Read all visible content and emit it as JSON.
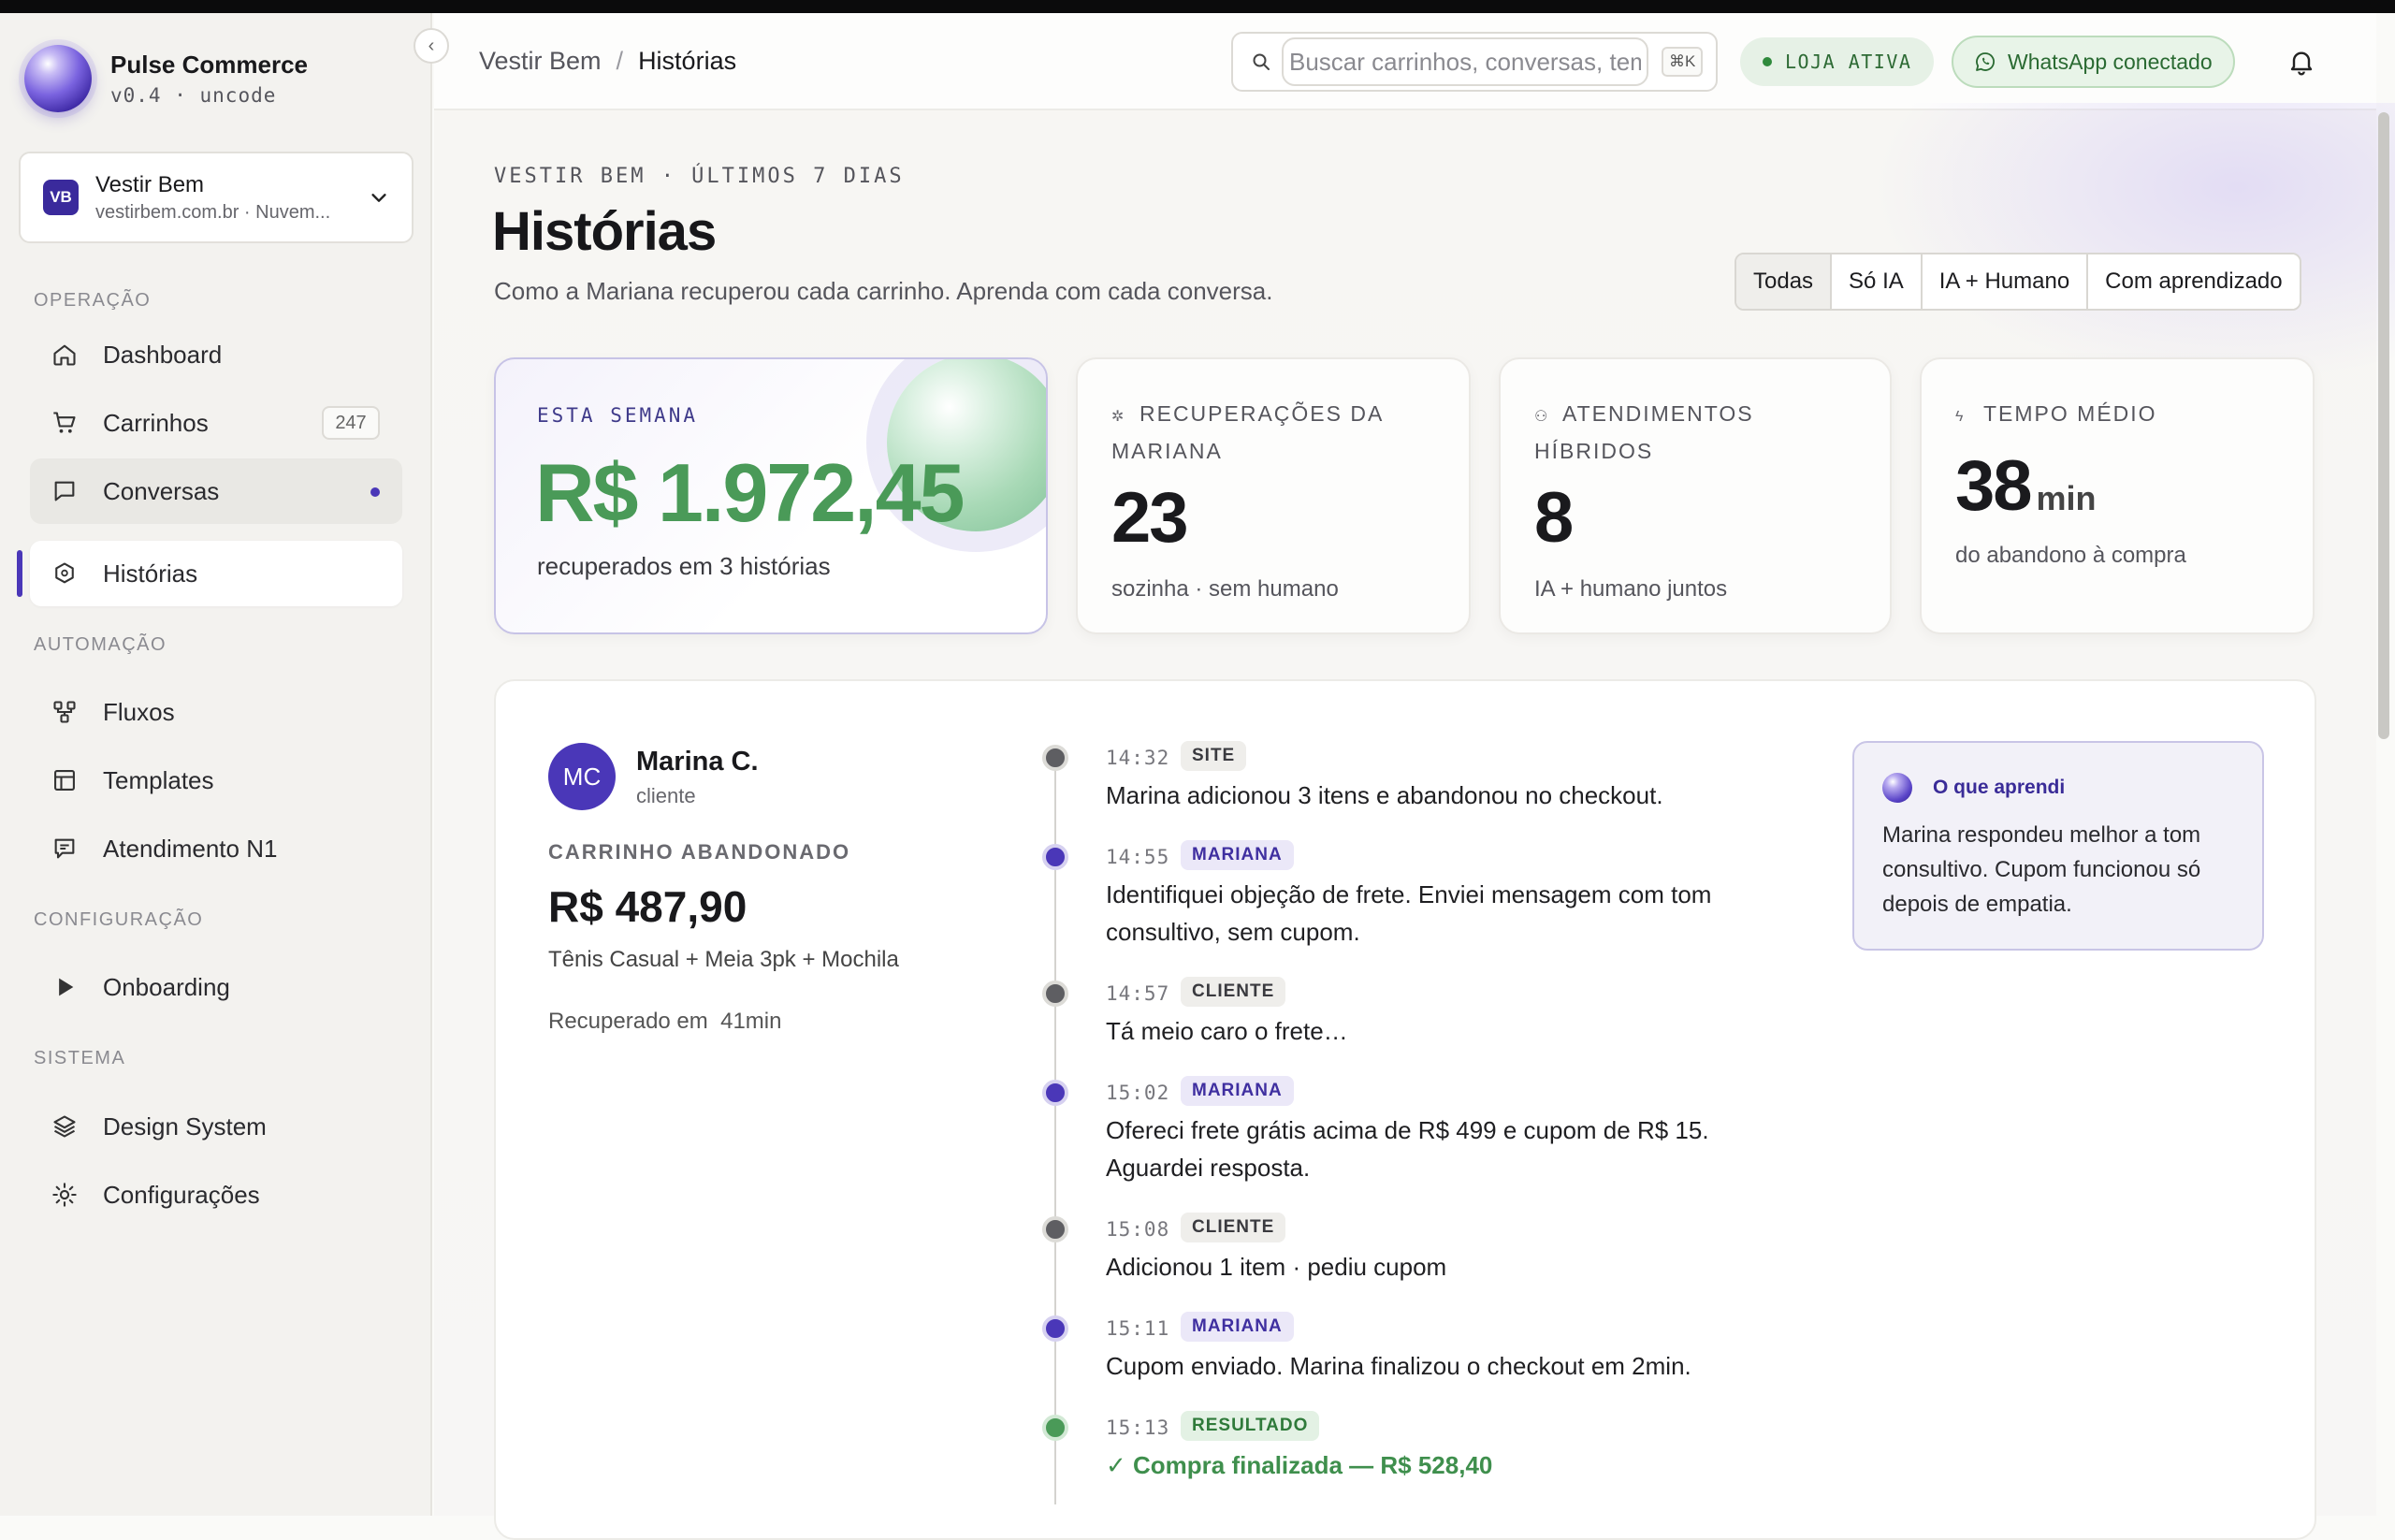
{
  "app": {
    "name": "Pulse Commerce",
    "version": "v0.4",
    "org": "uncode"
  },
  "store": {
    "initials": "VB",
    "name": "Vestir Bem",
    "url": "vestirbem.com.br · Nuvem..."
  },
  "sidebar": {
    "sections": [
      {
        "title": "OPERAÇÃO"
      },
      {
        "title": "AUTOMAÇÃO"
      },
      {
        "title": "CONFIGURAÇÃO"
      },
      {
        "title": "SISTEMA"
      }
    ],
    "items": [
      {
        "label": "Dashboard",
        "icon": "home-icon"
      },
      {
        "label": "Carrinhos",
        "icon": "cart-icon",
        "count": "247"
      },
      {
        "label": "Conversas",
        "icon": "chat-icon",
        "unread": true
      },
      {
        "label": "Histórias",
        "icon": "stories-icon",
        "active": true
      },
      {
        "label": "Fluxos",
        "icon": "flow-icon"
      },
      {
        "label": "Templates",
        "icon": "template-icon"
      },
      {
        "label": "Atendimento N1",
        "icon": "support-icon"
      },
      {
        "label": "Onboarding",
        "icon": "play-icon"
      },
      {
        "label": "Design System",
        "icon": "layers-icon"
      },
      {
        "label": "Configurações",
        "icon": "settings-icon"
      }
    ]
  },
  "header": {
    "breadcrumb": [
      "Vestir Bem",
      "Histórias"
    ],
    "search_placeholder": "Buscar carrinhos, conversas, templates…",
    "search_shortcut": "⌘K",
    "store_status": "LOJA ATIVA",
    "whatsapp_status": "WhatsApp conectado"
  },
  "page": {
    "eyebrow": "VESTIR BEM · ÚLTIMOS 7 DIAS",
    "title": "Histórias",
    "subtitle": "Como a Mariana recuperou cada carrinho. Aprenda com cada conversa.",
    "filters": [
      "Todas",
      "Só IA",
      "IA + Humano",
      "Com aprendizado"
    ],
    "active_filter": "Todas"
  },
  "stats": {
    "hero": {
      "label": "ESTA SEMANA",
      "value": "R$ 1.972,45",
      "note": "recuperados em 3 histórias"
    },
    "cards": [
      {
        "icon": "spark-icon",
        "label": "RECUPERAÇÕES DA MARIANA",
        "value": "23",
        "unit": "",
        "note": "sozinha · sem humano"
      },
      {
        "icon": "people-icon",
        "label": "ATENDIMENTOS HÍBRIDOS",
        "value": "8",
        "unit": "",
        "note": "IA + humano juntos"
      },
      {
        "icon": "bolt-icon",
        "label": "TEMPO MÉDIO",
        "value": "38",
        "unit": "min",
        "note": "do abandono à compra"
      }
    ]
  },
  "story": {
    "customer": {
      "initials": "MC",
      "name": "Marina C.",
      "role": "cliente"
    },
    "cart_label": "CARRINHO ABANDONADO",
    "cart_amount": "R$ 487,90",
    "cart_items": "Tênis Casual + Meia 3pk + Mochila",
    "recovered_label": "Recuperado em",
    "recovered_time": "41min",
    "timeline": [
      {
        "time": "14:32",
        "tag": "SITE",
        "kind": "grey",
        "text": "Marina adicionou 3 itens e abandonou no checkout."
      },
      {
        "time": "14:55",
        "tag": "MARIANA",
        "kind": "purple",
        "text": "Identifiquei objeção de frete. Enviei mensagem com tom consultivo, sem cupom."
      },
      {
        "time": "14:57",
        "tag": "CLIENTE",
        "kind": "grey",
        "text": "Tá meio caro o frete…"
      },
      {
        "time": "15:02",
        "tag": "MARIANA",
        "kind": "purple",
        "text": "Ofereci frete grátis acima de R$ 499 e cupom de R$ 15. Aguardei resposta."
      },
      {
        "time": "15:08",
        "tag": "CLIENTE",
        "kind": "grey",
        "text": "Adicionou 1 item · pediu cupom"
      },
      {
        "time": "15:11",
        "tag": "MARIANA",
        "kind": "purple",
        "text": "Cupom enviado. Marina finalizou o checkout em 2min."
      },
      {
        "time": "15:13",
        "tag": "RESULTADO",
        "kind": "green",
        "text": "✓ Compra finalizada — R$ 528,40"
      }
    ],
    "learning": {
      "title": "O que aprendi",
      "body": "Marina respondeu melhor a tom consultivo. Cupom funcionou só depois de empatia."
    }
  },
  "colors": {
    "accent": "#4a37b8",
    "success": "#4a9a58",
    "muted": "#55555c"
  }
}
